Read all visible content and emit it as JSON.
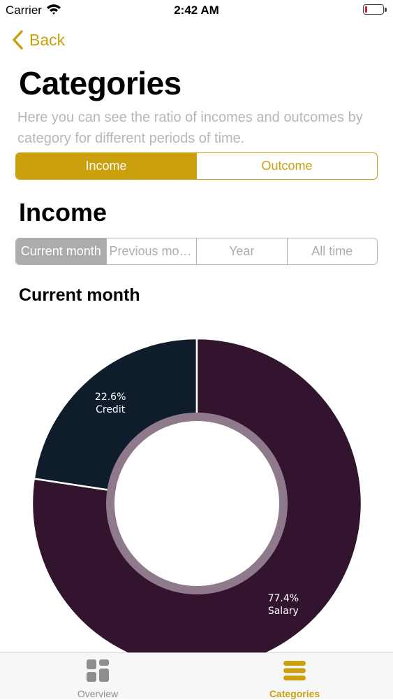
{
  "status_bar": {
    "carrier": "Carrier",
    "time": "2:42 AM"
  },
  "nav": {
    "back_label": "Back"
  },
  "page": {
    "title": "Categories",
    "description": "Here you can see the ratio of incomes and outcomes by category for different periods of time."
  },
  "type_selector": {
    "options": [
      "Income",
      "Outcome"
    ],
    "selected": "Income"
  },
  "section_title": "Income",
  "period_selector": {
    "options": [
      "Current month",
      "Previous month",
      "Year",
      "All time"
    ],
    "selected": "Current month"
  },
  "chart_title": "Current month",
  "chart_data": {
    "type": "pie",
    "title": "Current month",
    "slices": [
      {
        "label": "Credit",
        "value": 22.6,
        "display": "22.6%",
        "color": "#0f1c2c"
      },
      {
        "label": "Salary",
        "value": 77.4,
        "display": "77.4%",
        "color": "#33142f"
      }
    ]
  },
  "tab_bar": {
    "items": [
      {
        "label": "Overview",
        "icon": "grid-icon",
        "selected": false
      },
      {
        "label": "Categories",
        "icon": "list-icon",
        "selected": true
      }
    ]
  },
  "colors": {
    "accent": "#caa00c",
    "segment_inactive": "#acacac",
    "donut_inner_ring": "#8e7a8b"
  }
}
